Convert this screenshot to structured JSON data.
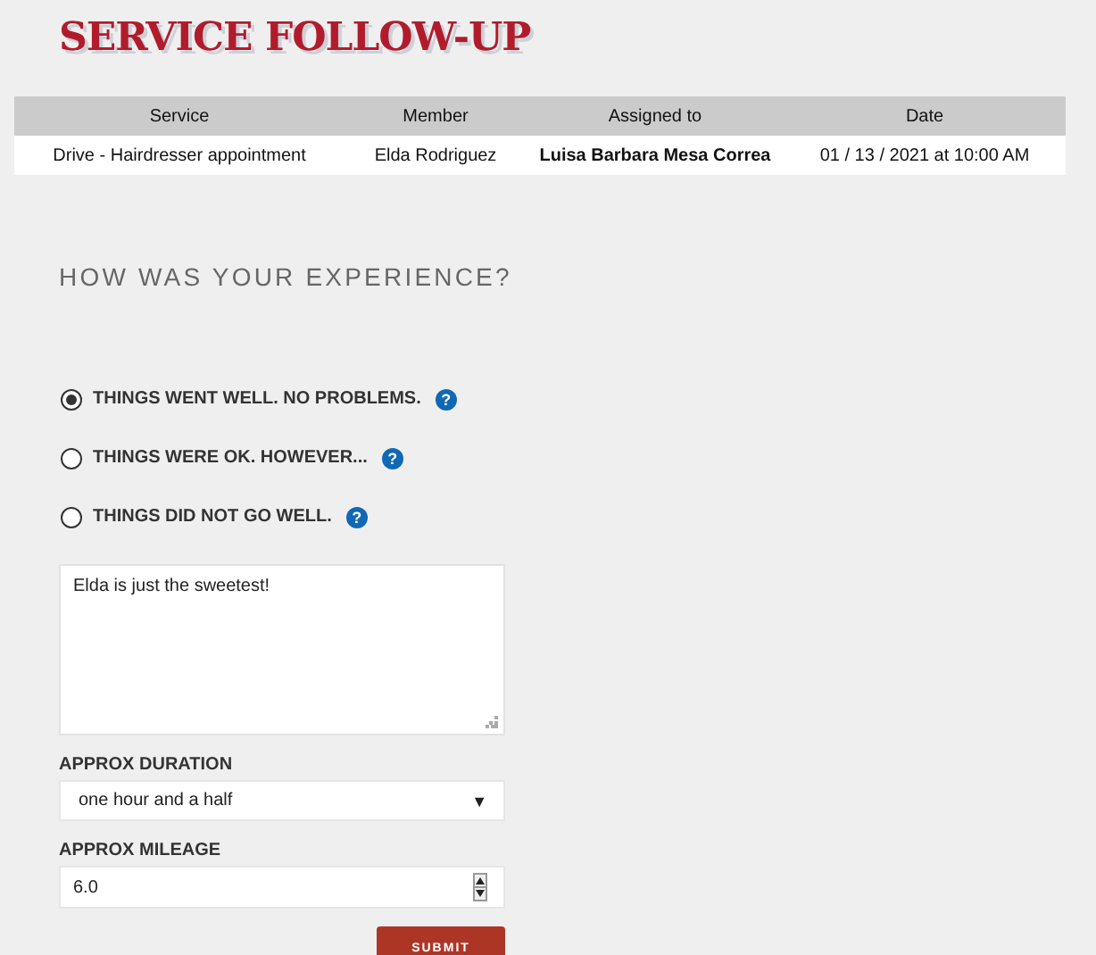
{
  "title": "SERVICE FOLLOW-UP",
  "table": {
    "columns": [
      "Service",
      "Member",
      "Assigned to",
      "Date"
    ],
    "rows": [
      {
        "cells": [
          "Drive - Hairdresser appointment",
          "Elda Rodriguez",
          "Luisa Barbara Mesa Correa",
          "01 / 13 / 2021 at 10:00 AM"
        ]
      }
    ]
  },
  "question": "HOW WAS YOUR EXPERIENCE?",
  "options": [
    {
      "label": "THINGS WENT WELL. NO PROBLEMS.",
      "help": "?",
      "selected": true
    },
    {
      "label": "THINGS WERE OK. HOWEVER...",
      "help": "?",
      "selected": false
    },
    {
      "label": "THINGS DID NOT GO WELL.",
      "help": "?",
      "selected": false
    }
  ],
  "comment": {
    "value": "Elda is just the sweetest!"
  },
  "duration": {
    "label": "APPROX DURATION",
    "value": "one hour and a half",
    "arrow": "▼"
  },
  "mileage": {
    "label": "APPROX MILEAGE",
    "value": "6.0"
  },
  "submit": "SUBMIT"
}
